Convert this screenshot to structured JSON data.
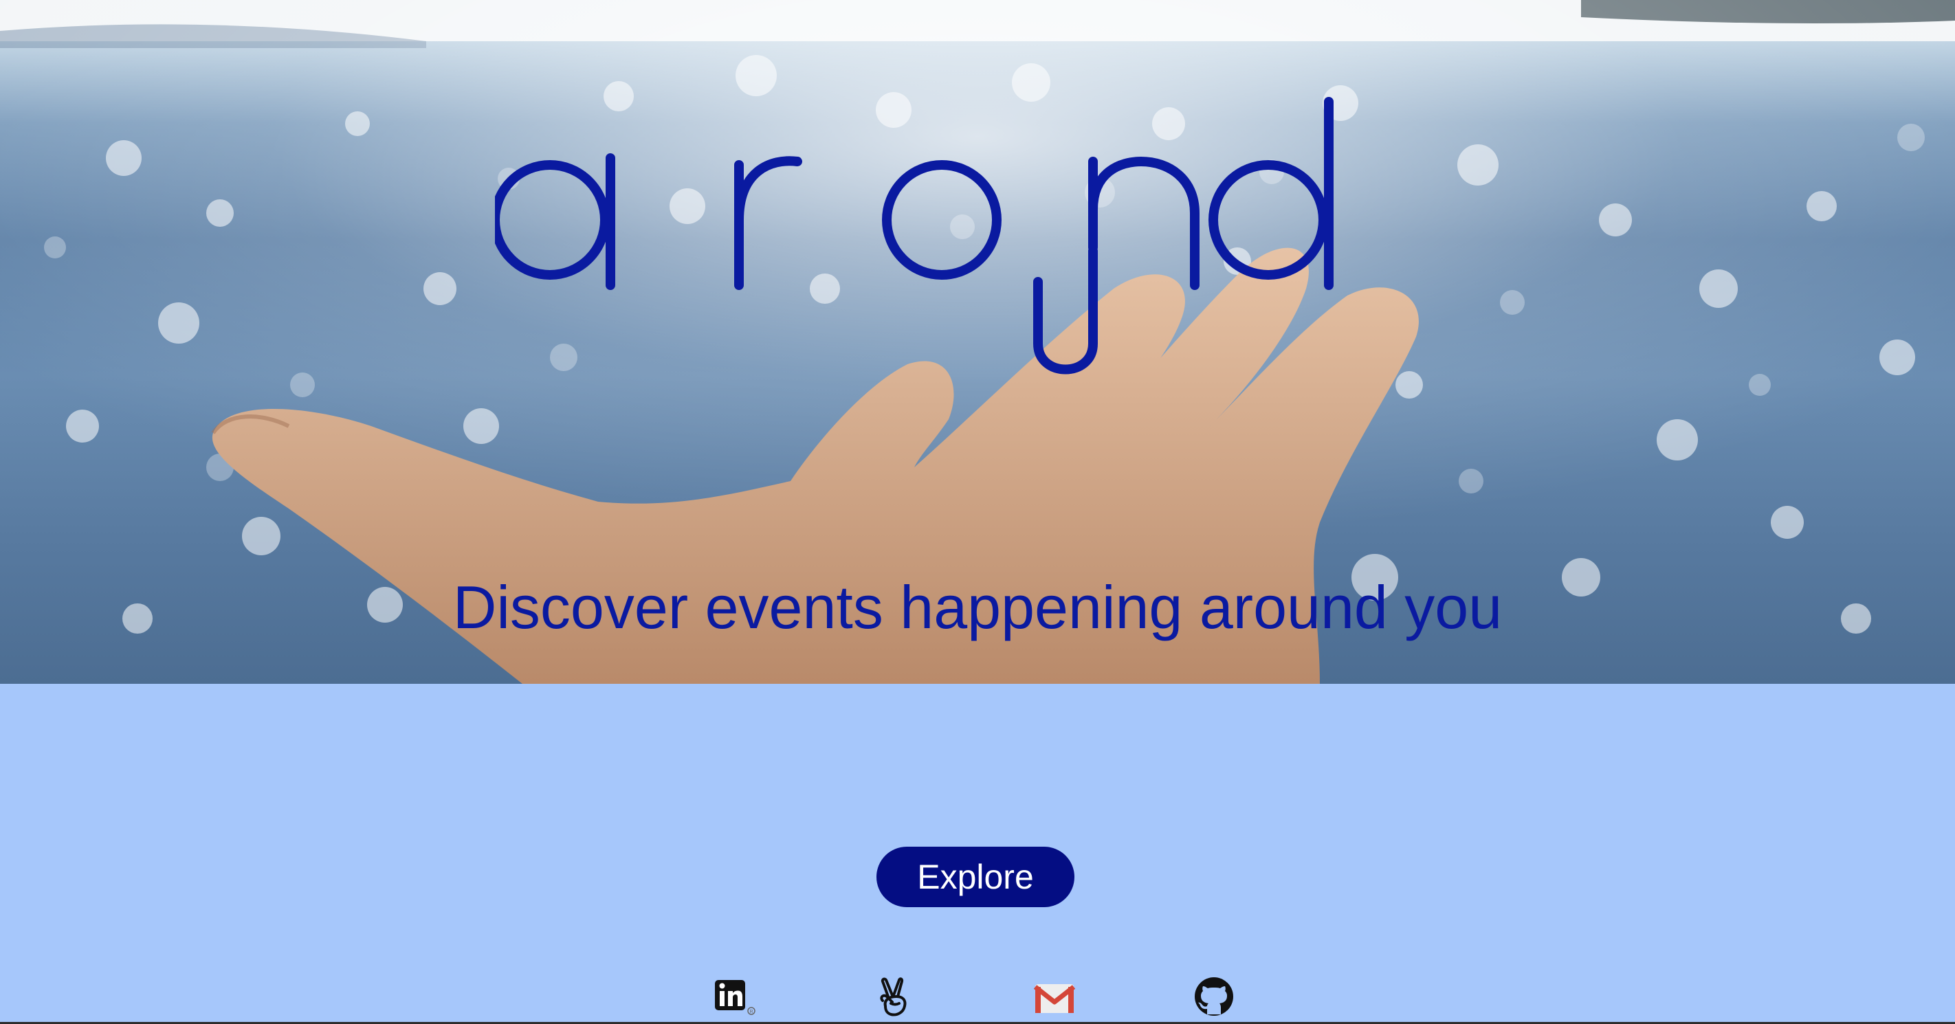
{
  "hero": {
    "logo_text": "around",
    "tagline": "Discover events happening around you",
    "logo_color": "#0a1aa0",
    "tagline_color": "#0a1aa0"
  },
  "main": {
    "explore_label": "Explore",
    "button_color": "#040d83",
    "background_color": "#a6c7fb"
  },
  "footer": {
    "icons": [
      "linkedin-icon",
      "angellist-icon",
      "gmail-icon",
      "github-icon"
    ]
  }
}
